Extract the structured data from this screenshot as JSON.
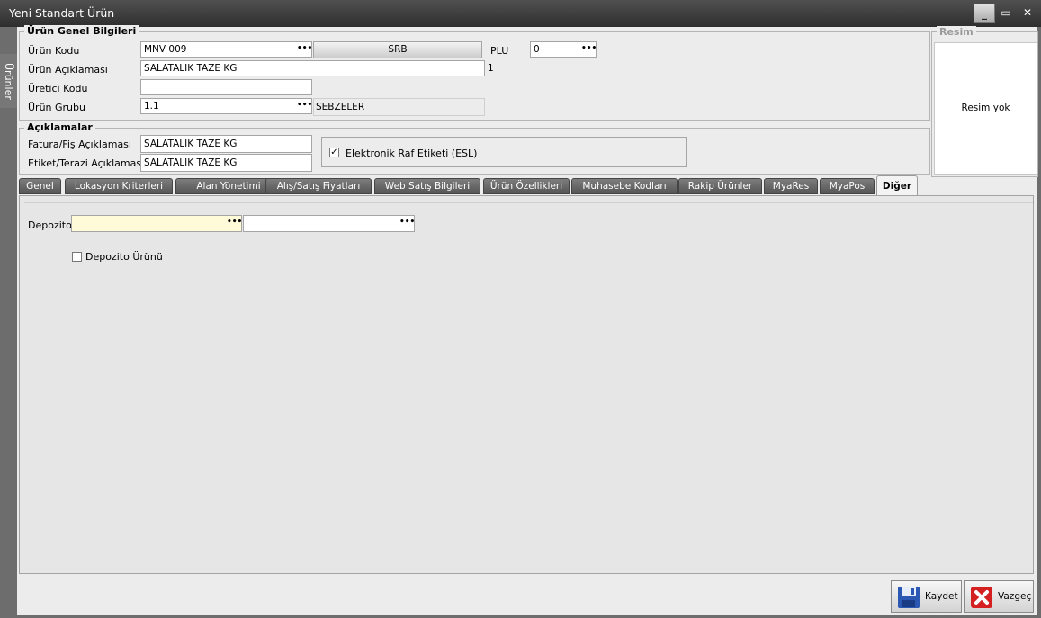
{
  "window": {
    "title": "Yeni Standart Ürün"
  },
  "sidebar": {
    "tab": "Ürünler"
  },
  "general": {
    "legend": "Ürün Genel Bilgileri",
    "product_code_label": "Ürün Kodu",
    "product_code": "MNV 009",
    "srb_button": "SRB",
    "plu_label": "PLU",
    "plu": "0",
    "desc_label": "Ürün Açıklaması",
    "desc": "SALATALIK TAZE KG",
    "desc_count": "1",
    "manufacturer_label": "Üretici Kodu",
    "manufacturer": "",
    "group_label": "Ürün Grubu",
    "group": "1.1",
    "group_name": "SEBZELER"
  },
  "descriptions": {
    "legend": "Açıklamalar",
    "invoice_label": "Fatura/Fiş Açıklaması",
    "invoice": "SALATALIK TAZE KG",
    "label_label": "Etiket/Terazi Açıklaması",
    "label": "SALATALIK TAZE KG",
    "esl_label": "Elektronik Raf Etiketi (ESL)",
    "esl_checked": true
  },
  "image": {
    "legend": "Resim",
    "empty": "Resim yok"
  },
  "tabs": [
    {
      "label": "Genel"
    },
    {
      "label": "Lokasyon Kriterleri"
    },
    {
      "label": "Alan Yönetimi"
    },
    {
      "label": "Alış/Satış Fiyatları"
    },
    {
      "label": "Web Satış Bilgileri"
    },
    {
      "label": "Ürün Özellikleri"
    },
    {
      "label": "Muhasebe Kodları"
    },
    {
      "label": "Rakip Ürünler"
    },
    {
      "label": "MyaRes"
    },
    {
      "label": "MyaPos"
    },
    {
      "label": "Diğer",
      "active": true
    }
  ],
  "other": {
    "depot_label": "Depozito",
    "depot_code": "",
    "depot_name": "",
    "depot_product_label": "Depozito Ürünü",
    "depot_product_checked": false
  },
  "footer": {
    "save": "Kaydet",
    "cancel": "Vazgeç"
  },
  "icons": {
    "minimize": "minimize-icon",
    "maximize": "maximize-icon",
    "close": "close-icon",
    "save": "floppy-disk-icon",
    "cancel": "red-x-icon"
  }
}
